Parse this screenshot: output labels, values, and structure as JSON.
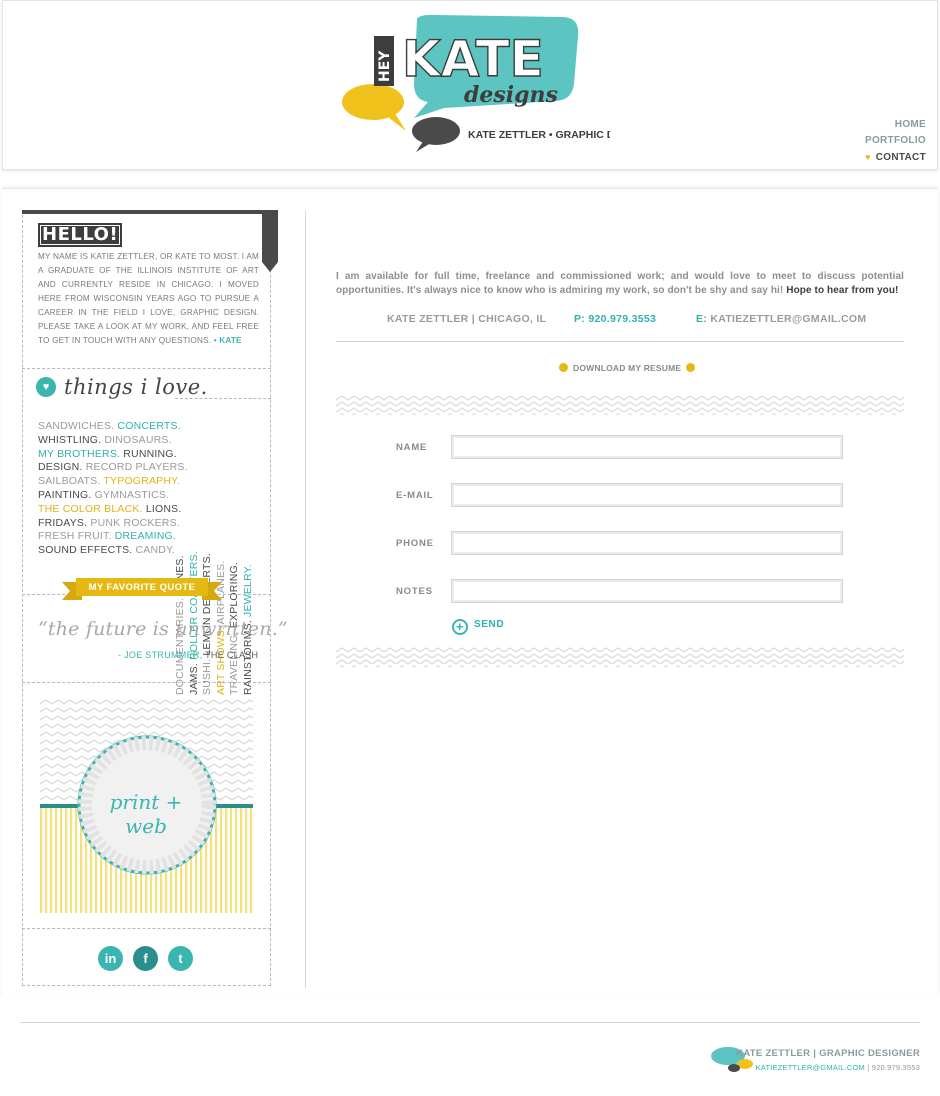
{
  "header": {
    "logo": {
      "hey": "HEY",
      "kate": "KATE",
      "designs": "designs",
      "tagline": "KATE ZETTLER • GRAPHIC DESIGNER"
    },
    "nav": [
      {
        "label": "HOME",
        "active": false
      },
      {
        "label": "PORTFOLIO",
        "active": false
      },
      {
        "label": "CONTACT",
        "active": true
      }
    ]
  },
  "sidebar": {
    "hello_title": "HELLO!",
    "hello_text": "My name is Katie Zettler, or Kate to most. I am a graduate of the Illinois Institute of Art and currently reside in Chicago. I moved here from Wisconsin years ago to pursue a career in the field I love, graphic design. Please take a look at my work, and feel free to get in touch with any questions.",
    "hello_sign": "• KATE",
    "love_title": "things i love.",
    "love_lines": [
      [
        {
          "t": "SANDWICHES. ",
          "c": "gray"
        },
        {
          "t": "CONCERTS.",
          "c": "teal"
        }
      ],
      [
        {
          "t": "WHISTLING. ",
          "c": "dark"
        },
        {
          "t": "DINOSAURS.",
          "c": "gray"
        }
      ],
      [
        {
          "t": "MY BROTHERS. ",
          "c": "teal"
        },
        {
          "t": "RUNNING.",
          "c": "dark"
        }
      ],
      [
        {
          "t": "DESIGN. ",
          "c": "dark"
        },
        {
          "t": "RECORD PLAYERS.",
          "c": "gray"
        }
      ],
      [
        {
          "t": "SAILBOATS. ",
          "c": "gray"
        },
        {
          "t": "TYPOGRAPHY.",
          "c": "yellow"
        }
      ],
      [
        {
          "t": "PAINTING. ",
          "c": "dark"
        },
        {
          "t": "GYMNASTICS.",
          "c": "gray"
        }
      ],
      [
        {
          "t": "THE COLOR BLACK. ",
          "c": "yellow"
        },
        {
          "t": "LIONS.",
          "c": "dark"
        }
      ],
      [
        {
          "t": "FRIDAYS. ",
          "c": "dark"
        },
        {
          "t": "PUNK ROCKERS.",
          "c": "gray"
        }
      ],
      [
        {
          "t": "FRESH FRUIT. ",
          "c": "gray"
        },
        {
          "t": "DREAMING.",
          "c": "teal"
        }
      ],
      [
        {
          "t": "SOUND EFFECTS. ",
          "c": "dark"
        },
        {
          "t": "CANDY.",
          "c": "gray"
        }
      ]
    ],
    "love_vertical": [
      [
        {
          "t": "DOCUMENTARIES. ",
          "c": "gray"
        },
        {
          "t": "TUNES.",
          "c": "dark"
        }
      ],
      [
        {
          "t": "JAMS. ",
          "c": "dark"
        },
        {
          "t": "ROLLER COASTERS.",
          "c": "teal"
        }
      ],
      [
        {
          "t": "SUSHI. ",
          "c": "gray"
        },
        {
          "t": "LEMON DESSERTS.",
          "c": "dark"
        }
      ],
      [
        {
          "t": "ART SHOWS. ",
          "c": "yellow"
        },
        {
          "t": "AIRPLANES.",
          "c": "gray"
        }
      ],
      [
        {
          "t": "TRAVELING. ",
          "c": "gray"
        },
        {
          "t": "EXPLORING.",
          "c": "dark"
        }
      ],
      [
        {
          "t": "RAINSTORMS. ",
          "c": "dark"
        },
        {
          "t": "JEWELRY.",
          "c": "teal"
        }
      ]
    ],
    "quote_banner": "MY FAVORITE QUOTE",
    "quote": "“the future is unwritten.”",
    "quote_author": "- JOE STRUMMER,",
    "quote_band": " THE CLASH",
    "print_web": "print + web",
    "social": [
      {
        "name": "linkedin",
        "glyph": "in"
      },
      {
        "name": "facebook",
        "glyph": "f"
      },
      {
        "name": "twitter",
        "glyph": "t"
      }
    ]
  },
  "main": {
    "intro_text": "I am available for full time, freelance and commissioned work; and would love to meet to discuss potential opportunities. It's always nice to know who is admiring my work, so don't be shy and say hi! ",
    "intro_emph": "Hope to hear from you!",
    "contact_name": "KATE ZETTLER | CHICAGO, IL",
    "phone_label": "P:",
    "phone": "920.979.3553",
    "email_label": "E:",
    "email": "KATIEZETTLER@GMAIL.COM",
    "resume_label": "DOWNLOAD MY RESUME",
    "form": {
      "name_label": "NAME",
      "email_label": "E-MAIL",
      "phone_label": "PHONE",
      "notes_label": "NOTES",
      "send_label": "SEND"
    }
  },
  "footer": {
    "name": "KATE ZETTLER | GRAPHIC DESIGNER",
    "email": "KATIEZETTLER@GMAIL.COM",
    "phone": " | 920.979.3553"
  },
  "colors": {
    "teal": "#3ab5b0",
    "yellow": "#e5b911",
    "dark": "#4a4a4a",
    "gray": "#9a9a9a"
  }
}
